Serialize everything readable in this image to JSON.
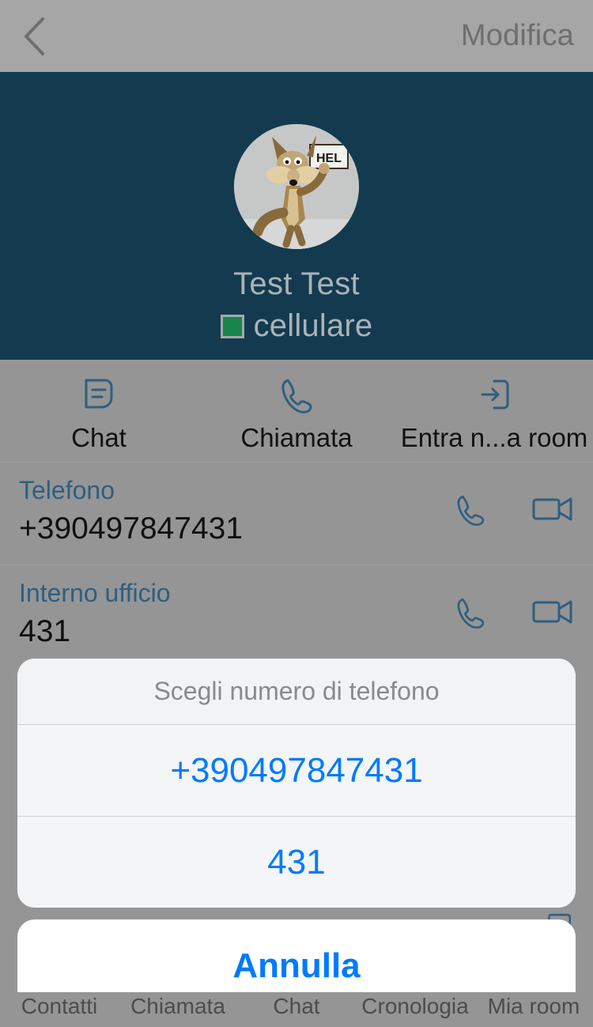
{
  "navbar": {
    "back_icon": "chevron-left-icon",
    "edit_label": "Modifica"
  },
  "profile": {
    "avatar_icon": "contact-avatar-coyote",
    "name": "Test Test",
    "presence_status": "cellulare",
    "presence_color": "#17854a",
    "background_color": "#143a4f"
  },
  "actions": [
    {
      "icon": "chat-bubble-icon",
      "label": "Chat"
    },
    {
      "icon": "phone-icon",
      "label": "Chiamata"
    },
    {
      "icon": "enter-room-icon",
      "label": "Entra n...a room"
    }
  ],
  "contact_fields": [
    {
      "label": "Telefono",
      "value": "+390497847431",
      "call_icon": "phone-icon",
      "video_icon": "video-camera-icon"
    },
    {
      "label": "Interno ufficio",
      "value": "431",
      "call_icon": "phone-icon",
      "video_icon": "video-camera-icon"
    }
  ],
  "action_sheet": {
    "title": "Scegli numero di telefono",
    "options": [
      {
        "label": "+390497847431"
      },
      {
        "label": "431"
      }
    ],
    "cancel_label": "Annulla",
    "accent_color": "#007aff"
  },
  "tabbar": {
    "items": [
      {
        "label": "Contatti"
      },
      {
        "label": "Chiamata"
      },
      {
        "label": "Chat"
      },
      {
        "label": "Cronologia"
      },
      {
        "label": "Mia room"
      }
    ]
  }
}
